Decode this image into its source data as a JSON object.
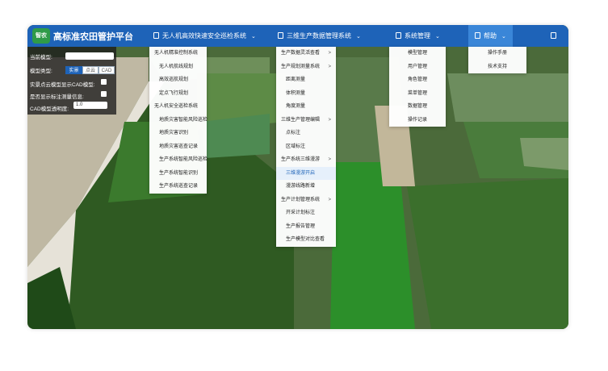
{
  "header": {
    "logo_text": "智农",
    "title": "高标准农田管护平台",
    "nav": [
      {
        "label": "无人机高效快速安全巡检系统"
      },
      {
        "label": "三维生产数据管理系统"
      },
      {
        "label": "系统管理"
      },
      {
        "label": "帮助"
      }
    ]
  },
  "menus": {
    "uav": [
      "无人机精准控制系统",
      "无人机航线规划",
      "高效巡航规划",
      "定点飞行规划",
      "无人机安全巡检系统",
      "地质灾害智能风险巡检",
      "地质灾害识别",
      "地质灾害巡查记录",
      "生产系统智能风险巡检",
      "生产系统智能识别",
      "生产系统巡查记录"
    ],
    "data3d": [
      "生产数据灵活查看",
      "生产规划测量系统",
      "距离测量",
      "体积测量",
      "角度测量",
      "三维生产管理编辑",
      "点标注",
      "区域标注",
      "生产系统三维漫游",
      "三维漫游开启",
      "漫游线路新增",
      "生产计划管理系统",
      "开采计划标注",
      "生产报告管理",
      "生产模型对比查看"
    ],
    "system": [
      "模型管理",
      "用户管理",
      "角色管理",
      "菜单管理",
      "数据管理",
      "操作记录"
    ],
    "help": [
      "操作手册",
      "技术支持"
    ]
  },
  "panel": {
    "current_model_label": "当前模型:",
    "model_type_label": "模型类型:",
    "segments": [
      "实景",
      "点云",
      "CAD"
    ],
    "show_cad_label": "实景点云模型显示CAD模型:",
    "show_measure_label": "是否显示标注测量信息:",
    "opacity_label": "CAD模型透明度:",
    "opacity_value": "1.0"
  },
  "colors": {
    "header_blue": "#1e63b8",
    "active_blue": "#3a86d8",
    "selected_text": "#1e63b8"
  }
}
